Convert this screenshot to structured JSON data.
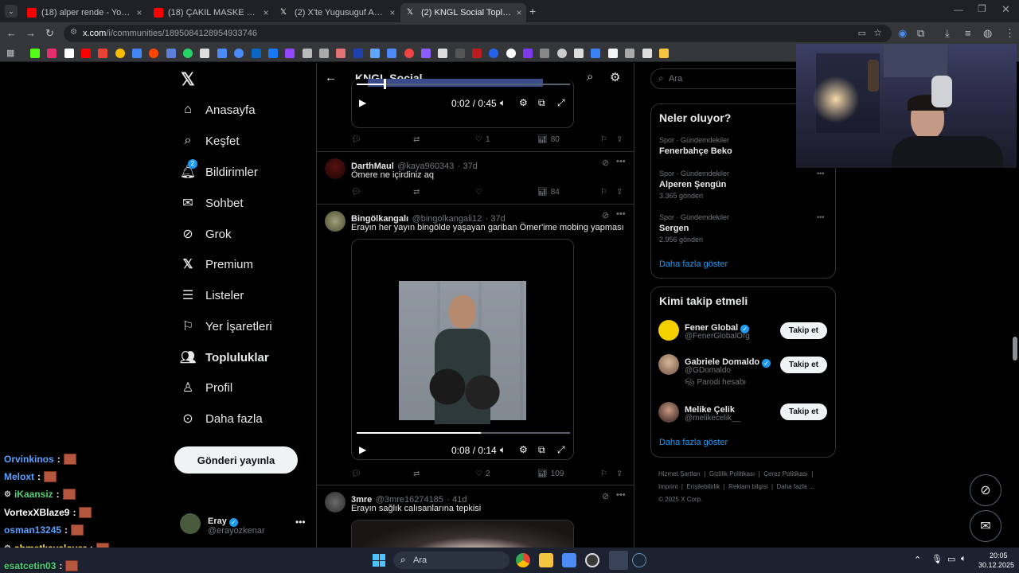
{
  "browser": {
    "tabs": [
      {
        "label": "(18) alper rende - YouTube",
        "color": "#ff0000"
      },
      {
        "label": "(18) ÇAKIL MASKE UYARISI VİR",
        "color": "#ff0000"
      },
      {
        "label": "(2) X'te Yugusuguf Arşiv: \"takla",
        "color": "#ffffff"
      },
      {
        "label": "(2) KNGL Social Topluluk / X",
        "color": "#ffffff"
      }
    ],
    "url_host": "x.com",
    "url_path": "/i/communities/1895084128954933746"
  },
  "sidebar": {
    "items": [
      {
        "label": "Anasayfa",
        "icon": "home-icon"
      },
      {
        "label": "Keşfet",
        "icon": "search-icon"
      },
      {
        "label": "Bildirimler",
        "icon": "bell-icon",
        "badge": "2"
      },
      {
        "label": "Sohbet",
        "icon": "mail-icon"
      },
      {
        "label": "Grok",
        "icon": "grok-icon"
      },
      {
        "label": "Premium",
        "icon": "x-logo-icon"
      },
      {
        "label": "Listeler",
        "icon": "list-icon"
      },
      {
        "label": "Yer İşaretleri",
        "icon": "bookmark-icon"
      },
      {
        "label": "Topluluklar",
        "icon": "communities-icon"
      },
      {
        "label": "Profil",
        "icon": "person-icon"
      },
      {
        "label": "Daha fazla",
        "icon": "more-circle-icon"
      }
    ],
    "post_button": "Gönderi yayınla",
    "account": {
      "name": "Eray",
      "handle": "@erayozkenar"
    }
  },
  "main": {
    "title": "KNGL Social",
    "top_video": {
      "time": "0:02 / 0:45",
      "likes": "1",
      "views": "80"
    },
    "posts": [
      {
        "name": "DarthMaul",
        "handle": "@kaya960343",
        "age": "· 37d",
        "text": "Ömere ne içirdiniz aq",
        "views": "84"
      },
      {
        "name": "Bingölkangalı",
        "handle": "@bingolkangali12",
        "age": "· 37d",
        "text": "Erayın her yayın bingölde yaşayan gariban Ömer'ime mobing yapması",
        "video_time": "0:08 / 0:14",
        "likes": "2",
        "views": "109"
      },
      {
        "name": "3mre",
        "handle": "@3mre16274185",
        "age": "· 41d",
        "text": "Erayın sağlık calısanlarına tepkisi"
      }
    ]
  },
  "right": {
    "search_placeholder": "Ara",
    "trends_title": "Neler oluyor?",
    "trends": [
      {
        "category": "Spor · Gündemdekiler",
        "name": "Fenerbahçe Beko",
        "count": ""
      },
      {
        "category": "Spor · Gündemdekiler",
        "name": "Alperen Şengün",
        "count": "3.365 gönderi"
      },
      {
        "category": "Spor · Gündemdekiler",
        "name": "Sergen",
        "count": "2.956 gönderi"
      }
    ],
    "show_more": "Daha fazla göster",
    "follow_title": "Kimi takip etmeli",
    "follow": [
      {
        "name": "Fener Global",
        "handle": "@FenerGlobalOrg",
        "note": ""
      },
      {
        "name": "Gabriele Domaldo",
        "handle": "@GDomaldo",
        "note": "Parodi hesabı"
      },
      {
        "name": "Melike Çelik",
        "handle": "@melikecelik__",
        "note": ""
      }
    ],
    "follow_button": "Takip et",
    "footer": [
      "Hizmet Şartları",
      "Gizlilik Politikası",
      "Çerez Politikası",
      "Imprint",
      "Erişilebilirlik",
      "Reklam bilgisi",
      "Daha fazla ...",
      "© 2025 X Corp."
    ]
  },
  "chat": [
    {
      "user": "Orvinkinos",
      "color": "#5aa0ff"
    },
    {
      "user": "Meloxt",
      "color": "#5aa0ff"
    },
    {
      "user": "iKaansiz",
      "color": "#4fd17a"
    },
    {
      "user": "VortexXBlaze9",
      "color": "#ffffff"
    },
    {
      "user": "osman13245",
      "color": "#5aa0ff"
    },
    {
      "user": "ahmetkayalover",
      "color": "#ffe14d"
    },
    {
      "user": "esatcetin03",
      "color": "#4fd17a"
    }
  ],
  "taskbar": {
    "search": "Ara",
    "time": "20:05",
    "date": "30.12.2025"
  }
}
